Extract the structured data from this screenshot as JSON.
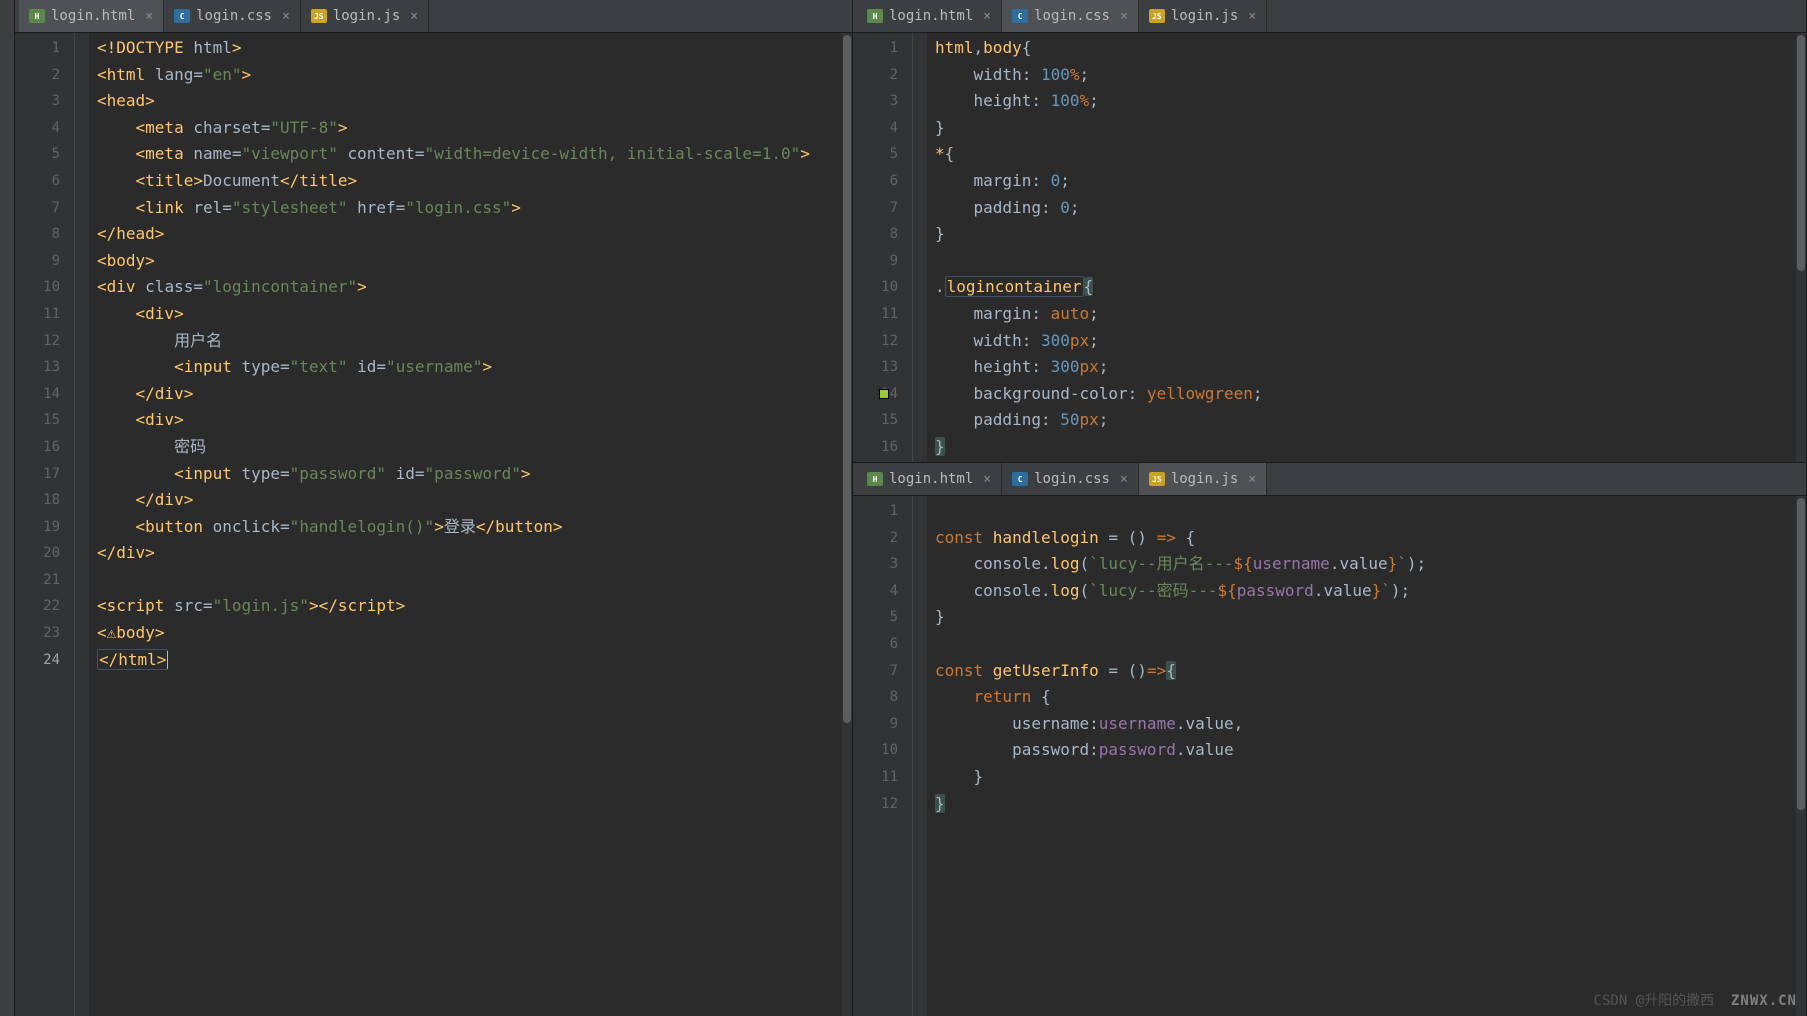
{
  "leftPane": {
    "tabs": [
      {
        "icon": "fi-html",
        "iconText": "H",
        "label": "login.html",
        "active": true
      },
      {
        "icon": "fi-css",
        "iconText": "C",
        "label": "login.css",
        "active": false
      },
      {
        "icon": "fi-js",
        "iconText": "JS",
        "label": "login.js",
        "active": false
      }
    ],
    "lines": 24,
    "cursorLine": 24,
    "code": [
      {
        "spans": [
          {
            "t": "<!DOCTYPE ",
            "c": "tag"
          },
          {
            "t": "html",
            "c": "attr"
          },
          {
            "t": ">",
            "c": "tag"
          }
        ]
      },
      {
        "spans": [
          {
            "t": "<",
            "c": "tag"
          },
          {
            "t": "html ",
            "c": "tag"
          },
          {
            "t": "lang",
            "c": "attr"
          },
          {
            "t": "=",
            "c": "txt"
          },
          {
            "t": "\"en\"",
            "c": "str"
          },
          {
            "t": ">",
            "c": "tag"
          }
        ]
      },
      {
        "spans": [
          {
            "t": "<head>",
            "c": "tag"
          }
        ]
      },
      {
        "spans": [
          {
            "t": "    ",
            "c": "txt"
          },
          {
            "t": "<meta ",
            "c": "tag"
          },
          {
            "t": "charset",
            "c": "attr"
          },
          {
            "t": "=",
            "c": "txt"
          },
          {
            "t": "\"UTF-8\"",
            "c": "str"
          },
          {
            "t": ">",
            "c": "tag"
          }
        ]
      },
      {
        "spans": [
          {
            "t": "    ",
            "c": "txt"
          },
          {
            "t": "<meta ",
            "c": "tag"
          },
          {
            "t": "name",
            "c": "attr"
          },
          {
            "t": "=",
            "c": "txt"
          },
          {
            "t": "\"viewport\"",
            "c": "str"
          },
          {
            "t": " ",
            "c": "txt"
          },
          {
            "t": "content",
            "c": "attr"
          },
          {
            "t": "=",
            "c": "txt"
          },
          {
            "t": "\"width=device-width, initial-scale=1.0\"",
            "c": "str"
          },
          {
            "t": ">",
            "c": "tag"
          }
        ]
      },
      {
        "spans": [
          {
            "t": "    ",
            "c": "txt"
          },
          {
            "t": "<title>",
            "c": "tag"
          },
          {
            "t": "Document",
            "c": "txt"
          },
          {
            "t": "</title>",
            "c": "tag"
          }
        ]
      },
      {
        "spans": [
          {
            "t": "    ",
            "c": "txt"
          },
          {
            "t": "<link ",
            "c": "tag"
          },
          {
            "t": "rel",
            "c": "attr"
          },
          {
            "t": "=",
            "c": "txt"
          },
          {
            "t": "\"stylesheet\"",
            "c": "str"
          },
          {
            "t": " ",
            "c": "txt"
          },
          {
            "t": "href",
            "c": "attr"
          },
          {
            "t": "=",
            "c": "txt"
          },
          {
            "t": "\"login.css\"",
            "c": "str"
          },
          {
            "t": ">",
            "c": "tag"
          }
        ]
      },
      {
        "spans": [
          {
            "t": "</head>",
            "c": "tag"
          }
        ]
      },
      {
        "spans": [
          {
            "t": "<body>",
            "c": "tag"
          }
        ]
      },
      {
        "spans": [
          {
            "t": "<div ",
            "c": "tag"
          },
          {
            "t": "class",
            "c": "attr"
          },
          {
            "t": "=",
            "c": "txt"
          },
          {
            "t": "\"",
            "c": "str"
          },
          {
            "t": "logincontainer",
            "c": "str"
          },
          {
            "t": "\"",
            "c": "str"
          },
          {
            "t": ">",
            "c": "tag"
          }
        ]
      },
      {
        "spans": [
          {
            "t": "    ",
            "c": "txt"
          },
          {
            "t": "<div>",
            "c": "tag"
          }
        ]
      },
      {
        "spans": [
          {
            "t": "        用户名",
            "c": "txt"
          }
        ]
      },
      {
        "spans": [
          {
            "t": "        ",
            "c": "txt"
          },
          {
            "t": "<input ",
            "c": "tag"
          },
          {
            "t": "type",
            "c": "attr"
          },
          {
            "t": "=",
            "c": "txt"
          },
          {
            "t": "\"text\"",
            "c": "str"
          },
          {
            "t": " ",
            "c": "txt"
          },
          {
            "t": "id",
            "c": "attr"
          },
          {
            "t": "=",
            "c": "txt"
          },
          {
            "t": "\"username\"",
            "c": "str"
          },
          {
            "t": ">",
            "c": "tag"
          }
        ]
      },
      {
        "spans": [
          {
            "t": "    ",
            "c": "txt"
          },
          {
            "t": "</div>",
            "c": "tag"
          }
        ]
      },
      {
        "spans": [
          {
            "t": "    ",
            "c": "txt"
          },
          {
            "t": "<div>",
            "c": "tag"
          }
        ]
      },
      {
        "spans": [
          {
            "t": "        密码",
            "c": "txt"
          }
        ]
      },
      {
        "spans": [
          {
            "t": "        ",
            "c": "txt"
          },
          {
            "t": "<input ",
            "c": "tag"
          },
          {
            "t": "type",
            "c": "attr"
          },
          {
            "t": "=",
            "c": "txt"
          },
          {
            "t": "\"password\"",
            "c": "str"
          },
          {
            "t": " ",
            "c": "txt"
          },
          {
            "t": "id",
            "c": "attr"
          },
          {
            "t": "=",
            "c": "txt"
          },
          {
            "t": "\"password\"",
            "c": "str"
          },
          {
            "t": ">",
            "c": "tag"
          }
        ]
      },
      {
        "spans": [
          {
            "t": "    ",
            "c": "txt"
          },
          {
            "t": "</div>",
            "c": "tag"
          }
        ]
      },
      {
        "spans": [
          {
            "t": "    ",
            "c": "txt"
          },
          {
            "t": "<button ",
            "c": "tag"
          },
          {
            "t": "onclick",
            "c": "attr"
          },
          {
            "t": "=",
            "c": "txt"
          },
          {
            "t": "\"",
            "c": "str"
          },
          {
            "t": "handlelogin",
            "c": "str"
          },
          {
            "t": "()\"",
            "c": "str"
          },
          {
            "t": ">",
            "c": "tag"
          },
          {
            "t": "登录",
            "c": "txt"
          },
          {
            "t": "</button>",
            "c": "tag"
          }
        ]
      },
      {
        "spans": [
          {
            "t": "</div>",
            "c": "tag"
          }
        ]
      },
      {
        "spans": [
          {
            "t": "",
            "c": "txt"
          }
        ]
      },
      {
        "spans": [
          {
            "t": "<script ",
            "c": "tag"
          },
          {
            "t": "src",
            "c": "attr"
          },
          {
            "t": "=",
            "c": "txt"
          },
          {
            "t": "\"login.js\"",
            "c": "str"
          },
          {
            "t": ">",
            "c": "tag"
          },
          {
            "t": "</script>",
            "c": "tag"
          }
        ]
      },
      {
        "spans": [
          {
            "t": "<",
            "c": "tag"
          },
          {
            "t": "⚠",
            "c": "fn"
          },
          {
            "t": "body>",
            "c": "tag"
          }
        ]
      },
      {
        "spans": [
          {
            "t": "</html>",
            "c": "tag box"
          }
        ]
      }
    ]
  },
  "rightTop": {
    "tabs": [
      {
        "icon": "fi-html",
        "iconText": "H",
        "label": "login.html",
        "active": false
      },
      {
        "icon": "fi-css",
        "iconText": "C",
        "label": "login.css",
        "active": true
      },
      {
        "icon": "fi-js",
        "iconText": "JS",
        "label": "login.js",
        "active": false
      }
    ],
    "lines": 16,
    "colorSwatchLine": 14,
    "code": [
      {
        "spans": [
          {
            "t": "html",
            "c": "sel"
          },
          {
            "t": ",",
            "c": "txt"
          },
          {
            "t": "body",
            "c": "sel"
          },
          {
            "t": "{",
            "c": "txt"
          }
        ]
      },
      {
        "spans": [
          {
            "t": "    ",
            "c": "txt"
          },
          {
            "t": "width",
            "c": "prop"
          },
          {
            "t": ": ",
            "c": "txt"
          },
          {
            "t": "100",
            "c": "num"
          },
          {
            "t": "%",
            "c": "decl"
          },
          {
            "t": ";",
            "c": "txt"
          }
        ]
      },
      {
        "spans": [
          {
            "t": "    ",
            "c": "txt"
          },
          {
            "t": "height",
            "c": "prop"
          },
          {
            "t": ": ",
            "c": "txt"
          },
          {
            "t": "100",
            "c": "num"
          },
          {
            "t": "%",
            "c": "decl"
          },
          {
            "t": ";",
            "c": "txt"
          }
        ]
      },
      {
        "spans": [
          {
            "t": "}",
            "c": "txt"
          }
        ]
      },
      {
        "spans": [
          {
            "t": "*",
            "c": "sel"
          },
          {
            "t": "{",
            "c": "txt"
          }
        ]
      },
      {
        "spans": [
          {
            "t": "    ",
            "c": "txt"
          },
          {
            "t": "margin",
            "c": "prop"
          },
          {
            "t": ": ",
            "c": "txt"
          },
          {
            "t": "0",
            "c": "num"
          },
          {
            "t": ";",
            "c": "txt"
          }
        ]
      },
      {
        "spans": [
          {
            "t": "    ",
            "c": "txt"
          },
          {
            "t": "padding",
            "c": "prop"
          },
          {
            "t": ": ",
            "c": "txt"
          },
          {
            "t": "0",
            "c": "num"
          },
          {
            "t": ";",
            "c": "txt"
          }
        ]
      },
      {
        "spans": [
          {
            "t": "}",
            "c": "txt"
          }
        ]
      },
      {
        "spans": [
          {
            "t": "",
            "c": "txt"
          }
        ]
      },
      {
        "spans": [
          {
            "t": ".",
            "c": "txt"
          },
          {
            "t": "logincontainer",
            "c": "sel box"
          },
          {
            "t": "{",
            "c": "txt hlbrace"
          }
        ]
      },
      {
        "spans": [
          {
            "t": "    ",
            "c": "txt"
          },
          {
            "t": "margin",
            "c": "prop"
          },
          {
            "t": ": ",
            "c": "txt"
          },
          {
            "t": "auto",
            "c": "decl"
          },
          {
            "t": ";",
            "c": "txt"
          }
        ]
      },
      {
        "spans": [
          {
            "t": "    ",
            "c": "txt"
          },
          {
            "t": "width",
            "c": "prop"
          },
          {
            "t": ": ",
            "c": "txt"
          },
          {
            "t": "300",
            "c": "num"
          },
          {
            "t": "px",
            "c": "decl"
          },
          {
            "t": ";",
            "c": "txt"
          }
        ]
      },
      {
        "spans": [
          {
            "t": "    ",
            "c": "txt"
          },
          {
            "t": "height",
            "c": "prop"
          },
          {
            "t": ": ",
            "c": "txt"
          },
          {
            "t": "300",
            "c": "num"
          },
          {
            "t": "px",
            "c": "decl"
          },
          {
            "t": ";",
            "c": "txt"
          }
        ]
      },
      {
        "spans": [
          {
            "t": "    ",
            "c": "txt"
          },
          {
            "t": "background-color",
            "c": "prop"
          },
          {
            "t": ": ",
            "c": "txt"
          },
          {
            "t": "yellowgreen",
            "c": "decl"
          },
          {
            "t": ";",
            "c": "txt"
          }
        ]
      },
      {
        "spans": [
          {
            "t": "    ",
            "c": "txt"
          },
          {
            "t": "padding",
            "c": "prop"
          },
          {
            "t": ": ",
            "c": "txt"
          },
          {
            "t": "50",
            "c": "num"
          },
          {
            "t": "px",
            "c": "decl"
          },
          {
            "t": ";",
            "c": "txt"
          }
        ]
      },
      {
        "spans": [
          {
            "t": "}",
            "c": "txt hlbrace"
          }
        ]
      }
    ]
  },
  "rightBottom": {
    "tabs": [
      {
        "icon": "fi-html",
        "iconText": "H",
        "label": "login.html",
        "active": false
      },
      {
        "icon": "fi-css",
        "iconText": "C",
        "label": "login.css",
        "active": false
      },
      {
        "icon": "fi-js",
        "iconText": "JS",
        "label": "login.js",
        "active": true
      }
    ],
    "lines": 12,
    "code": [
      {
        "spans": [
          {
            "t": "",
            "c": "txt"
          }
        ]
      },
      {
        "spans": [
          {
            "t": "const ",
            "c": "kw"
          },
          {
            "t": "handlelogin",
            "c": "js-id"
          },
          {
            "t": " = () ",
            "c": "txt"
          },
          {
            "t": "=>",
            "c": "kw"
          },
          {
            "t": " {",
            "c": "txt"
          }
        ]
      },
      {
        "spans": [
          {
            "t": "    console.",
            "c": "txt"
          },
          {
            "t": "log",
            "c": "fn"
          },
          {
            "t": "(",
            "c": "txt"
          },
          {
            "t": "`lucy--用户名---",
            "c": "tmpl"
          },
          {
            "t": "${",
            "c": "kw"
          },
          {
            "t": "username",
            "c": "id"
          },
          {
            "t": ".value",
            "c": "txt"
          },
          {
            "t": "}",
            "c": "kw"
          },
          {
            "t": "`",
            "c": "tmpl"
          },
          {
            "t": ");",
            "c": "txt"
          }
        ]
      },
      {
        "spans": [
          {
            "t": "    console.",
            "c": "txt"
          },
          {
            "t": "log",
            "c": "fn"
          },
          {
            "t": "(",
            "c": "txt"
          },
          {
            "t": "`lucy--密码---",
            "c": "tmpl"
          },
          {
            "t": "${",
            "c": "kw"
          },
          {
            "t": "password",
            "c": "id"
          },
          {
            "t": ".value",
            "c": "txt"
          },
          {
            "t": "}",
            "c": "kw"
          },
          {
            "t": "`",
            "c": "tmpl"
          },
          {
            "t": ");",
            "c": "txt"
          }
        ]
      },
      {
        "spans": [
          {
            "t": "}",
            "c": "txt"
          }
        ]
      },
      {
        "spans": [
          {
            "t": "",
            "c": "txt"
          }
        ]
      },
      {
        "spans": [
          {
            "t": "const ",
            "c": "kw"
          },
          {
            "t": "getUserInfo",
            "c": "js-id"
          },
          {
            "t": " = ()",
            "c": "txt"
          },
          {
            "t": "=>",
            "c": "kw"
          },
          {
            "t": "{",
            "c": "txt hlbrace"
          }
        ]
      },
      {
        "spans": [
          {
            "t": "    ",
            "c": "txt"
          },
          {
            "t": "return ",
            "c": "kw"
          },
          {
            "t": "{",
            "c": "txt"
          }
        ]
      },
      {
        "spans": [
          {
            "t": "        username:",
            "c": "txt"
          },
          {
            "t": "username",
            "c": "id"
          },
          {
            "t": ".value,",
            "c": "txt"
          }
        ]
      },
      {
        "spans": [
          {
            "t": "        password:",
            "c": "txt"
          },
          {
            "t": "password",
            "c": "id"
          },
          {
            "t": ".value",
            "c": "txt"
          }
        ]
      },
      {
        "spans": [
          {
            "t": "    }",
            "c": "txt"
          }
        ]
      },
      {
        "spans": [
          {
            "t": "}",
            "c": "txt hlbrace"
          }
        ]
      }
    ]
  },
  "watermark": {
    "prefix": "CSDN @",
    "handle": "升阳的撒西",
    "logo": "ZNWX.CN"
  }
}
